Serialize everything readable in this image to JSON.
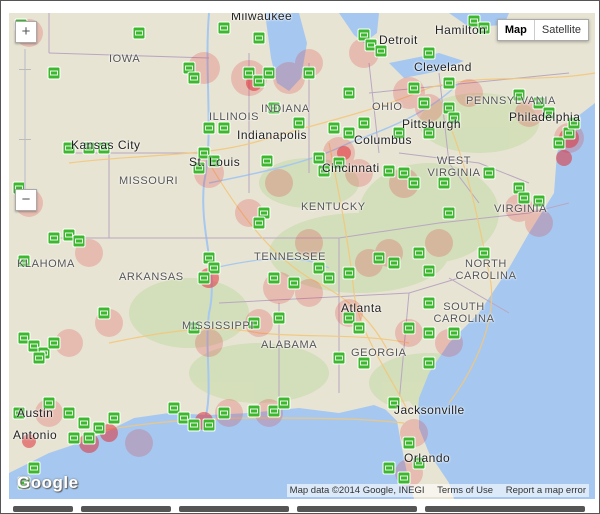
{
  "map": {
    "type_control": {
      "map_label": "Map",
      "satellite_label": "Satellite"
    },
    "zoom": {
      "in_label": "+",
      "out_label": "−"
    },
    "attribution": {
      "data": "Map data ©2014 Google, INEGI",
      "terms": "Terms of Use",
      "report": "Report a map error"
    },
    "logo": "Google",
    "states": [
      "IOWA",
      "ILLINOIS",
      "INDIANA",
      "OHIO",
      "PENNSYLVANIA",
      "MISSOURI",
      "KENTUCKY",
      "WEST VIRGINIA",
      "VIRGINIA",
      "ARKANSAS",
      "TENNESSEE",
      "NORTH CAROLINA",
      "KLAHOMA",
      "SOUTH CAROLINA",
      "MISSISSIPPI",
      "ALABAMA",
      "GEORGIA"
    ],
    "cities": [
      "Milwaukee",
      "Hamilton",
      "Detroit",
      "Cleveland",
      "Kansas City",
      "Indianapolis",
      "Columbus",
      "Pittsburgh",
      "Philadelphia",
      "St. Louis",
      "Cincinnati",
      "Atlanta",
      "Jacksonville",
      "Orlando",
      "Austin",
      "Antonio"
    ],
    "colors": {
      "marker": "#3cb82e",
      "heat": "#e0323a",
      "water": "#a6c8f0",
      "land": "#e8e4d3"
    }
  }
}
